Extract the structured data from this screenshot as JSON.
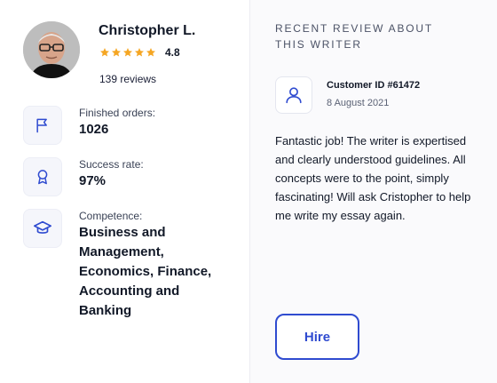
{
  "writer": {
    "name": "Christopher L.",
    "rating": "4.8",
    "stars": 5,
    "reviews": "139 reviews"
  },
  "stats": [
    {
      "icon": "flag-icon",
      "label": "Finished orders:",
      "value": "1026"
    },
    {
      "icon": "award-icon",
      "label": "Success rate:",
      "value": "97%"
    },
    {
      "icon": "graduation-cap-icon",
      "label": "Competence:",
      "value": "Business and Management, Economics, Finance, Accounting and Banking"
    }
  ],
  "review": {
    "section_title": "RECENT REVIEW ABOUT THIS WRITER",
    "customer_id": "Customer ID #61472",
    "date": "8 August 2021",
    "text": "Fantastic job! The writer is expertised and clearly understood guidelines. All concepts were to the point, simply fascinating! Will ask Cristopher to help me write my essay again."
  },
  "hire_label": "Hire",
  "colors": {
    "accent": "#2f4bd0",
    "star": "#f5a623",
    "panel_bg": "#fafafc"
  }
}
